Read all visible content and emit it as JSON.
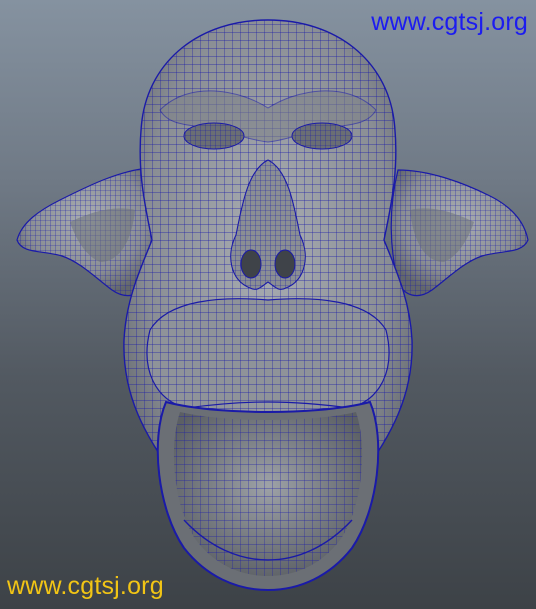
{
  "viewport": {
    "subject_icon": "wireframe-monkey-head-model",
    "wireframe_color": "#1a1aa8",
    "shading_color": "#8f949a",
    "background_top": "#8592a0",
    "background_bottom": "#3d4247"
  },
  "watermarks": {
    "top_right": {
      "text": "www.cgtsj.org",
      "color": "#1c1cf0"
    },
    "bottom_left": {
      "text": "www.cgtsj.org",
      "color": "#f2c515"
    }
  }
}
